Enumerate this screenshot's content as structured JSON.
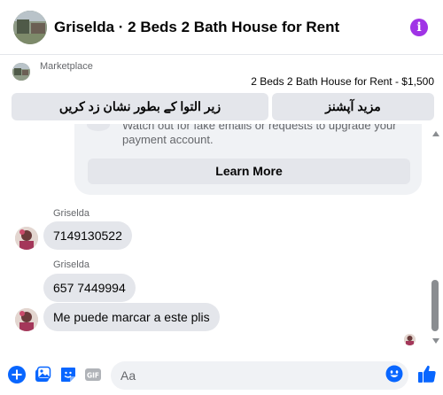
{
  "header": {
    "title": "Griselda · 2 Beds 2 Bath House for Rent",
    "info_icon": "info-icon"
  },
  "marketplace": {
    "label": "Marketplace",
    "listing": "2 Beds 2 Bath House for Rent - $1,500",
    "actions": {
      "mark_label": "زیر التوا کے بطور نشان زد کریں",
      "more_options_label": "مزید آپشنز"
    }
  },
  "safety_card": {
    "warning_text": "Watch out for fake emails or requests to upgrade your payment account.",
    "learn_more_label": "Learn More"
  },
  "messages": [
    {
      "sender": "Griselda",
      "text": "7149130522"
    },
    {
      "sender": "Griselda",
      "text": "657 7449994"
    },
    {
      "sender": "",
      "text": "Me puede marcar a este plis"
    }
  ],
  "composer": {
    "placeholder": "Aa",
    "icons": [
      "plus-icon",
      "photo-icon",
      "sticker-icon",
      "gif-icon",
      "emoji-icon",
      "thumbs-up-icon"
    ],
    "gif_label": "GIF"
  },
  "colors": {
    "accent": "#0866ff",
    "info": "#a033e6",
    "bubble": "#e4e6eb",
    "secondary_text": "#65676b"
  }
}
